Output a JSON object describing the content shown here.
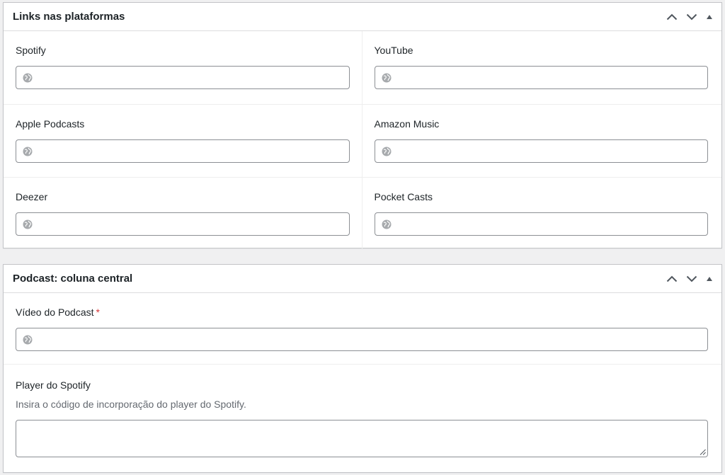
{
  "metabox_platforms": {
    "title": "Links nas plataformas",
    "move_up_icon": "chevron-up-icon",
    "move_down_icon": "chevron-down-icon",
    "toggle_icon": "triangle-up-icon",
    "fields": [
      {
        "label": "Spotify",
        "value": "",
        "icon": "globe-icon"
      },
      {
        "label": "YouTube",
        "value": "",
        "icon": "globe-icon"
      },
      {
        "label": "Apple Podcasts",
        "value": "",
        "icon": "globe-icon"
      },
      {
        "label": "Amazon Music",
        "value": "",
        "icon": "globe-icon"
      },
      {
        "label": "Deezer",
        "value": "",
        "icon": "globe-icon"
      },
      {
        "label": "Pocket Casts",
        "value": "",
        "icon": "globe-icon"
      }
    ]
  },
  "metabox_center": {
    "title": "Podcast: coluna central",
    "move_up_icon": "chevron-up-icon",
    "move_down_icon": "chevron-down-icon",
    "toggle_icon": "triangle-up-icon",
    "video": {
      "label": "Vídeo do Podcast",
      "required_mark": "*",
      "value": "",
      "icon": "globe-icon"
    },
    "spotify_player": {
      "label": "Player do Spotify",
      "description": "Insira o código de incorporação do player do Spotify.",
      "value": ""
    }
  },
  "colors": {
    "background": "#f0f0f1",
    "panel": "#ffffff",
    "border": "#c3c4c7",
    "input_border": "#8c8f94",
    "text": "#1d2327",
    "description": "#646970",
    "required": "#d63638",
    "icon": "#8c8f94"
  }
}
